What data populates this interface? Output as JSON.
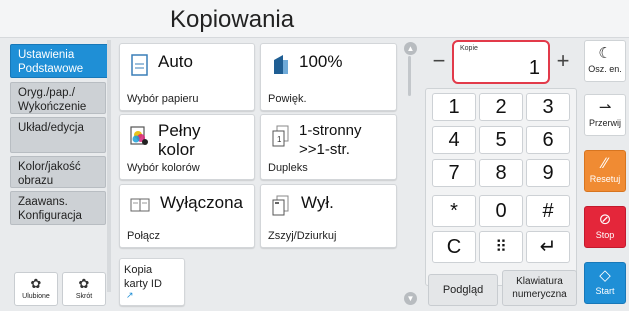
{
  "header": {
    "title": "Kopiowania"
  },
  "tabs": [
    {
      "label_line1": "Ustawienia",
      "label_line2": "Podstawowe"
    },
    {
      "label_line1": "Oryg./pap./",
      "label_line2": "Wykończenie"
    },
    {
      "label_line1": "Układ/edycja",
      "label_line2": ""
    },
    {
      "label_line1": "Kolor/jakość",
      "label_line2": "obrazu"
    },
    {
      "label_line1": "Zaawans.",
      "label_line2": "Konfiguracja"
    }
  ],
  "bottom_left": {
    "favorites_label": "Ulubione",
    "shortcut_label": "Skrót"
  },
  "tiles": {
    "paper": {
      "value": "Auto",
      "label": "Wybór papieru"
    },
    "zoom": {
      "value": "100%",
      "label": "Powięk."
    },
    "color": {
      "value_line1": "Pełny",
      "value_line2": "kolor",
      "label": "Wybór kolorów"
    },
    "duplex": {
      "value_line1": "1-stronny",
      "value_line2": ">>1-str.",
      "label": "Dupleks"
    },
    "combine": {
      "value": "Wyłączona",
      "label": "Połącz"
    },
    "staple": {
      "value": "Wył.",
      "label": "Zszyj/Dziurkuj"
    },
    "idcard": {
      "line1": "Kopia",
      "line2": "karty ID"
    }
  },
  "copies": {
    "label": "Kopie",
    "value": "1",
    "minus": "−",
    "plus": "+"
  },
  "keypad": {
    "keys": [
      "1",
      "2",
      "3",
      "4",
      "5",
      "6",
      "7",
      "8",
      "9",
      "*",
      "0",
      "#"
    ],
    "clear": "C",
    "grid": "⠿",
    "enter": "↵"
  },
  "footer": {
    "preview_label": "Podgląd",
    "numeric_keyboard_line1": "Klawiatura",
    "numeric_keyboard_line2": "numeryczna"
  },
  "right_panel": {
    "energy_label": "Osz. en.",
    "interrupt_label": "Przerwij",
    "reset_label": "Resetuj",
    "stop_label": "Stop",
    "start_label": "Start"
  },
  "colors": {
    "accent_blue": "#1f8fd6",
    "reset_orange": "#f08b33",
    "stop_red": "#e4263a",
    "highlight_red": "#e23a4a"
  },
  "icons": [
    "paper-icon",
    "zoom-icon",
    "color-icon",
    "duplex-icon",
    "combine-icon",
    "staple-icon",
    "idcard-icon",
    "gear-icon",
    "moon-icon",
    "interrupt-icon",
    "reset-icon",
    "stop-icon",
    "start-icon"
  ]
}
